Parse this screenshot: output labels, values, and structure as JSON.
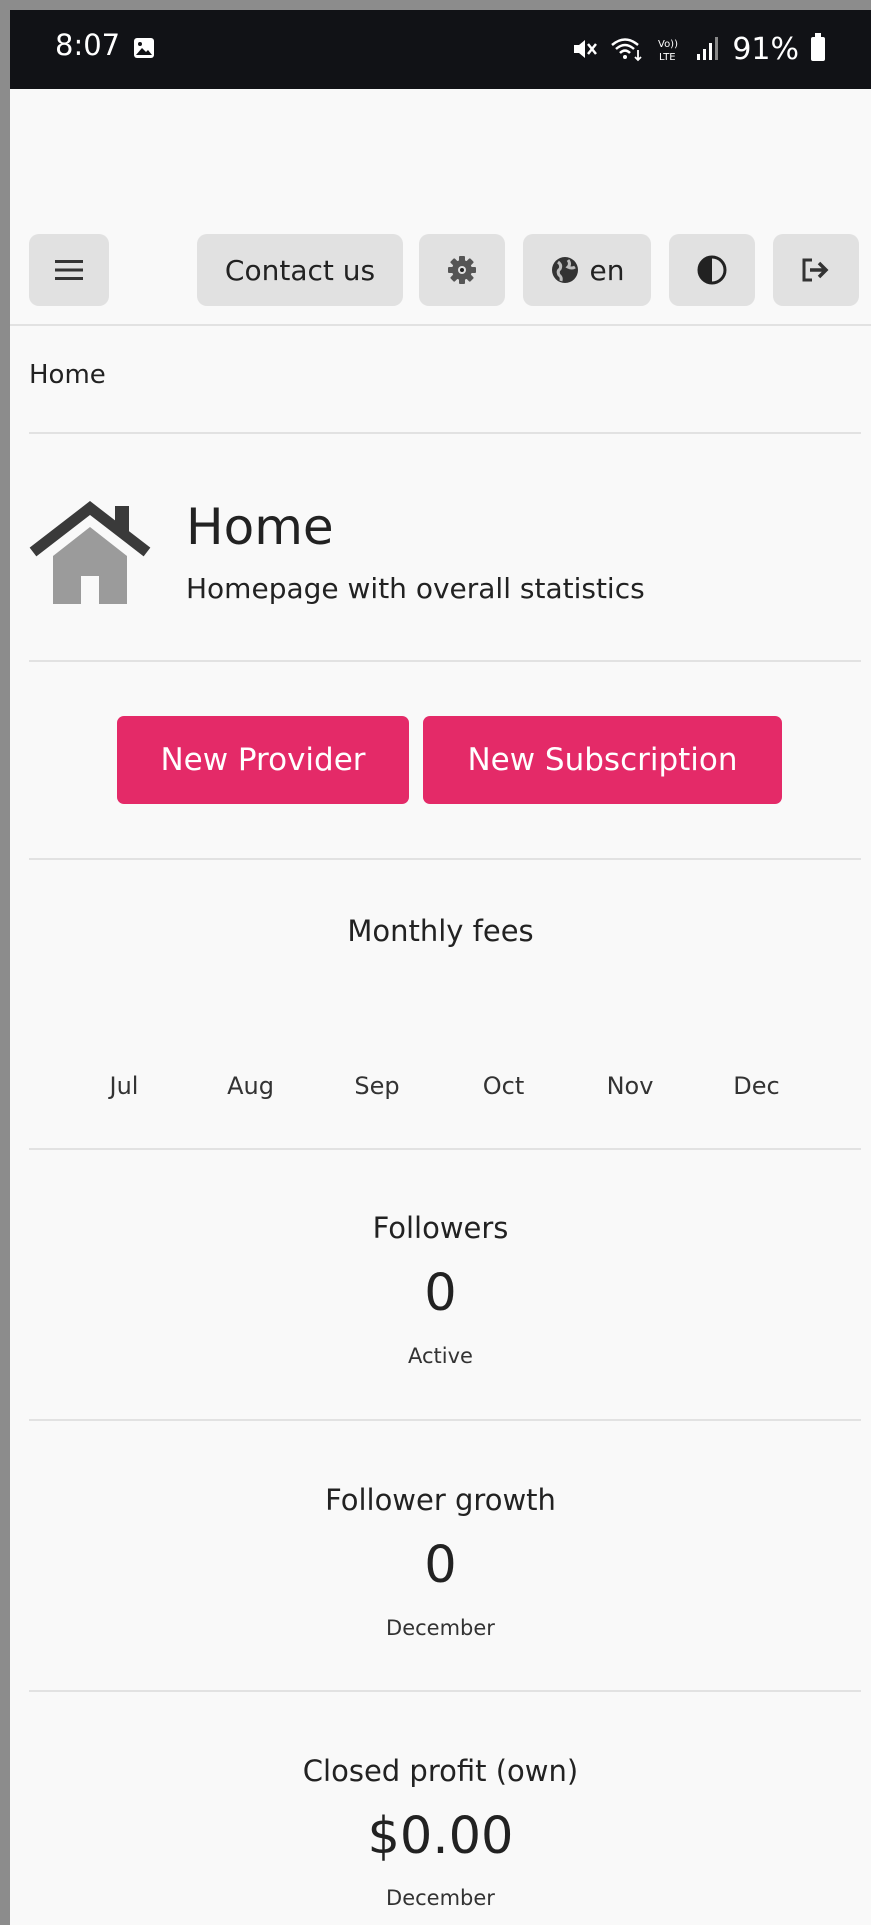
{
  "status_bar": {
    "time": "8:07",
    "battery_percent": "91%",
    "icons": [
      "gallery-icon",
      "mute-icon",
      "wifi-icon",
      "volte-icon",
      "signal-icon",
      "battery-icon"
    ]
  },
  "nav": {
    "contact_label": "Contact us",
    "language_label": "en",
    "icons": [
      "menu-icon",
      "gear-icon",
      "globe-icon",
      "contrast-icon",
      "logout-icon"
    ]
  },
  "breadcrumb": "Home",
  "page": {
    "title": "Home",
    "subtitle": "Homepage with overall statistics",
    "icon": "house-icon"
  },
  "actions": {
    "new_provider": "New Provider",
    "new_subscription": "New Subscription",
    "accent_color": "#e42a68"
  },
  "chart_data": {
    "type": "bar",
    "title": "Monthly fees",
    "categories": [
      "Jul",
      "Aug",
      "Sep",
      "Oct",
      "Nov",
      "Dec"
    ],
    "values": [
      0,
      0,
      0,
      0,
      0,
      0
    ]
  },
  "stats": {
    "followers": {
      "title": "Followers",
      "value": "0",
      "sub": "Active"
    },
    "growth": {
      "title": "Follower growth",
      "value": "0",
      "sub": "December"
    },
    "profit": {
      "title": "Closed profit (own)",
      "value": "$0.00",
      "sub": "December"
    }
  }
}
